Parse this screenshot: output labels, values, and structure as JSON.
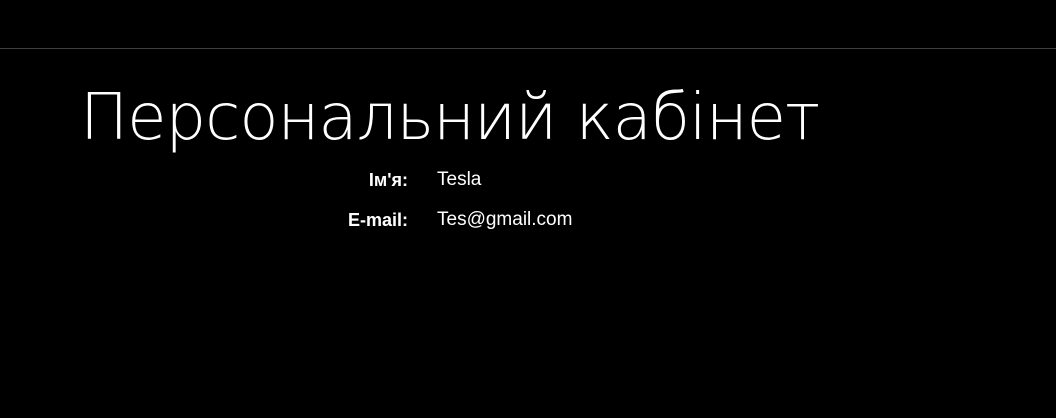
{
  "header": {
    "divider_color": "#3f3f3f"
  },
  "page": {
    "title": "Персональний кабінет",
    "background_color": "#000000",
    "text_color": "#ffffff"
  },
  "profile": {
    "fields": [
      {
        "label": "Ім'я:",
        "value": "Tesla"
      },
      {
        "label": "E-mail:",
        "value": "Tes@gmail.com"
      }
    ]
  }
}
